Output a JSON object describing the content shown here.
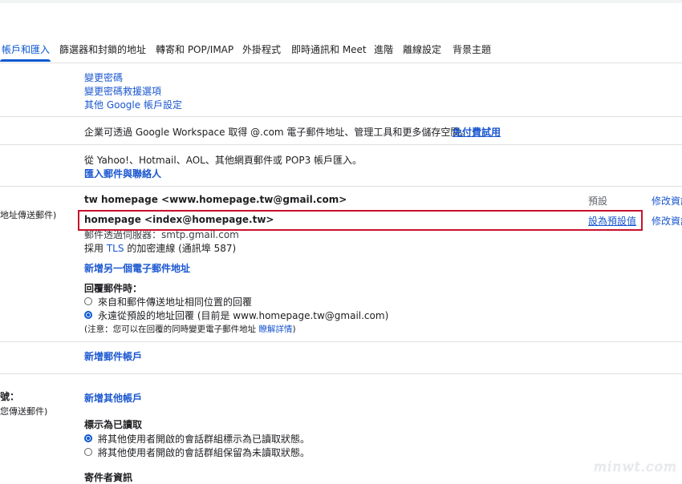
{
  "tabs": [
    {
      "label": "帳戶和匯入",
      "active": true
    },
    {
      "label": "篩選器和封鎖的地址"
    },
    {
      "label": "轉寄和 POP/IMAP"
    },
    {
      "label": "外掛程式"
    },
    {
      "label": "即時通訊和 Meet"
    },
    {
      "label": "進階"
    },
    {
      "label": "離線設定"
    },
    {
      "label": "背景主題"
    }
  ],
  "password_section": {
    "change_password": "變更密碼",
    "change_recovery": "變更密碼救援選項",
    "other_settings": "其他 Google 帳戶設定"
  },
  "workspace_section": {
    "text": "企業可透過 Google Workspace 取得 @.com 電子郵件地址、管理工具和更多儲存空間。",
    "trial_link": "免付費試用"
  },
  "import_section": {
    "text": "從 Yahoo!、Hotmail、AOL、其他網頁郵件或 POP3 帳戶匯入。",
    "import_link": "匯入郵件與聯絡人"
  },
  "send_mail_section": {
    "side_label": "地址傳送郵件)",
    "addresses": [
      {
        "name": "tw homepage <www.homepage.tw@gmail.com>",
        "status": "預設",
        "edit": "修改資訊"
      },
      {
        "name": "homepage <index@homepage.tw>",
        "action": "設為預設值",
        "edit": "修改資訊"
      }
    ],
    "smtp_text": "郵件透過伺服器：smtp.gmail.com",
    "tls_prefix": "採用",
    "tls_word": "TLS",
    "tls_suffix": "的加密連線 (通訊埠 587)",
    "add_address_link": "新增另一個電子郵件地址",
    "reply_heading": "回覆郵件時：",
    "reply_options": [
      {
        "label": "來自和郵件傳送地址相同位置的回覆",
        "checked": false
      },
      {
        "label": "永遠從預設的地址回覆 (目前是 www.homepage.tw@gmail.com)",
        "checked": true
      }
    ],
    "note": "(注意：您可以在回覆的同時變更電子郵件地址",
    "note_link": "瞭解詳情",
    "note_end": ")"
  },
  "check_mail_section": {
    "add_account_link": "新增郵件帳戶"
  },
  "grant_access_section": {
    "side_label_1": "號：",
    "side_label_2": "您傳送郵件)",
    "add_other_link": "新增其他帳戶",
    "mark_read_heading": "標示為已讀取",
    "mark_read_options": [
      {
        "label": "將其他使用者開啟的會話群組標示為已讀取狀態。",
        "checked": true
      },
      {
        "label": "將其他使用者開啟的會話群組保留為未讀取狀態。",
        "checked": false
      }
    ],
    "sender_info_heading": "寄件者資訊"
  },
  "watermark": "minwt.com",
  "colors": {
    "accent": "#0b57d0",
    "link": "#1a57d0",
    "highlight_box": "#c8102e"
  }
}
